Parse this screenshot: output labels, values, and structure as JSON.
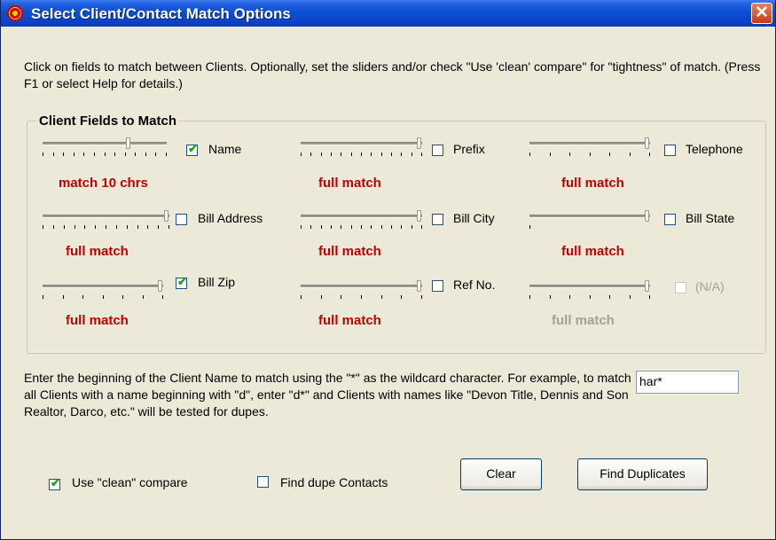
{
  "window": {
    "title": "Select Client/Contact Match Options"
  },
  "instructions": "Click on fields to match between Clients.  Optionally, set the sliders and/or check \"Use 'clean' compare\" for \"tightness\" of match.  (Press F1 or select Help for details.)",
  "group": {
    "title": "Client Fields to Match",
    "fields": [
      {
        "label": "Name",
        "checked": true,
        "enabled": true,
        "match": "match 10 chrs",
        "slider_value": 0.7
      },
      {
        "label": "Prefix",
        "checked": false,
        "enabled": true,
        "match": "full match",
        "slider_value": 1.0
      },
      {
        "label": "Telephone",
        "checked": false,
        "enabled": true,
        "match": "full match",
        "slider_value": 1.0
      },
      {
        "label": "Bill Address",
        "checked": false,
        "enabled": true,
        "match": "full match",
        "slider_value": 1.0
      },
      {
        "label": "Bill City",
        "checked": false,
        "enabled": true,
        "match": "full match",
        "slider_value": 1.0
      },
      {
        "label": "Bill State",
        "checked": false,
        "enabled": true,
        "match": "full match",
        "slider_value": 1.0
      },
      {
        "label": "Bill Zip",
        "checked": true,
        "enabled": true,
        "match": "full match",
        "slider_value": 1.0
      },
      {
        "label": "Ref No.",
        "checked": false,
        "enabled": true,
        "match": "full match",
        "slider_value": 1.0
      },
      {
        "label": "(N/A)",
        "checked": false,
        "enabled": false,
        "match": "full match",
        "slider_value": 1.0
      }
    ]
  },
  "wildcard": {
    "text": "Enter the beginning of the Client Name to match using the \"*\" as the wildcard character.  For example, to match all Clients with a name beginning with \"d\", enter \"d*\" and Clients with names like \"Devon Title, Dennis and Son Realtor, Darco, etc.\" will be tested for dupes.",
    "value": "har*"
  },
  "options": {
    "clean_compare": {
      "label": "Use \"clean\" compare",
      "checked": true
    },
    "dupe_contacts": {
      "label": "Find dupe Contacts",
      "checked": false
    }
  },
  "buttons": {
    "clear": "Clear",
    "find": "Find Duplicates"
  }
}
